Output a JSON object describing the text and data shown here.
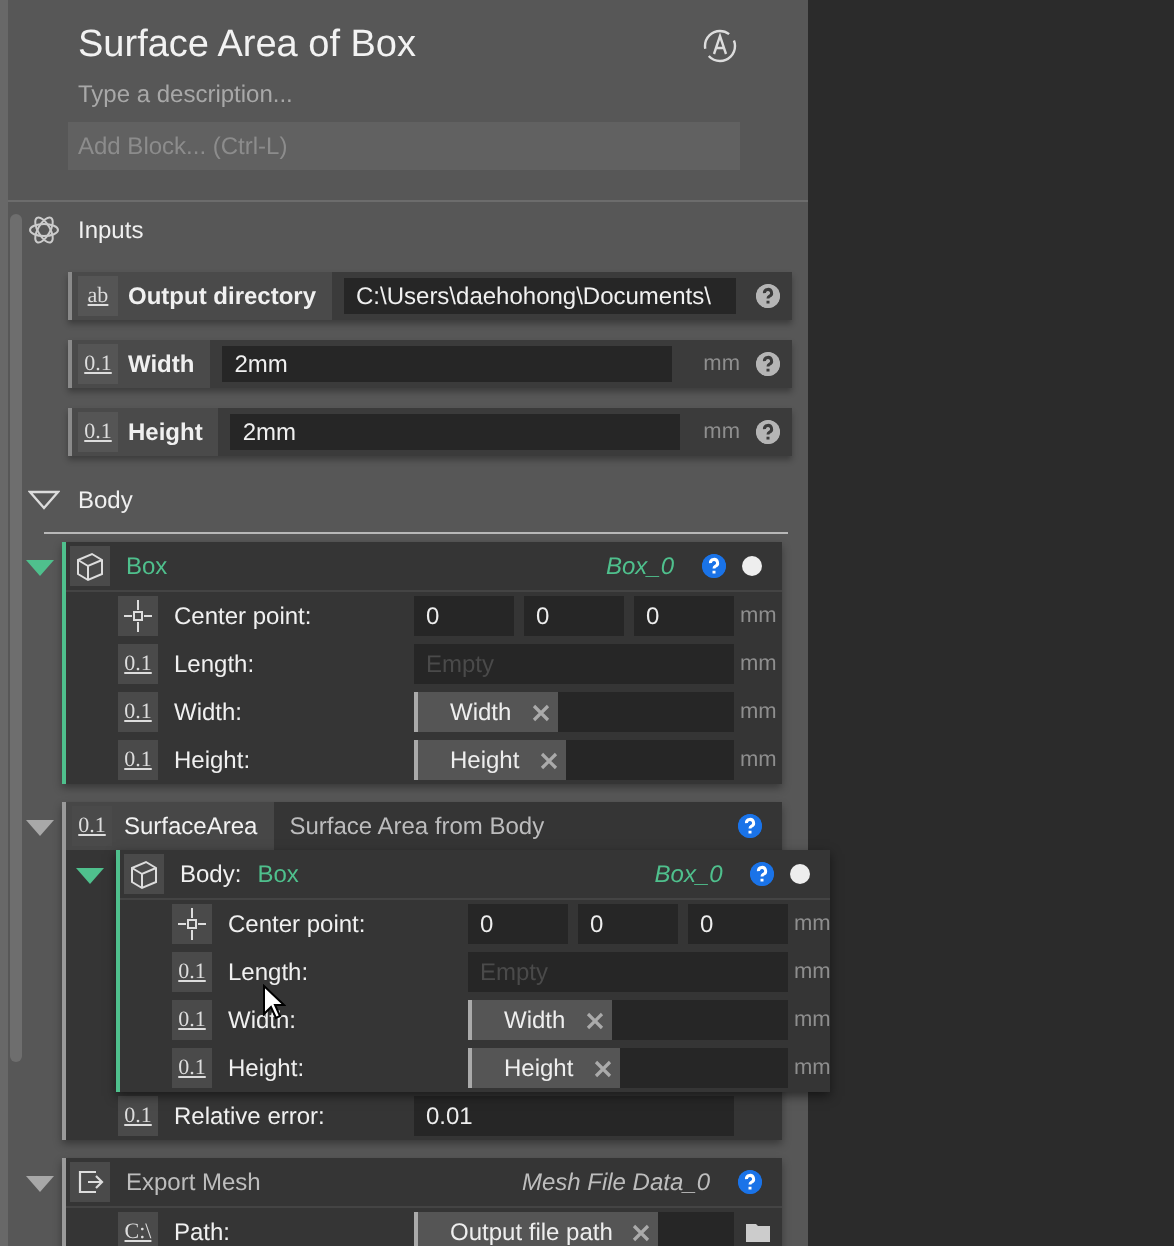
{
  "title": "Surface Area of Box",
  "description": {
    "placeholder": "Type a description..."
  },
  "add_block": {
    "placeholder": "Add Block... (Ctrl-L)"
  },
  "inputs": {
    "label": "Inputs",
    "rows": [
      {
        "icon": "ab",
        "label": "Output directory",
        "value": "C:\\Users\\daehohong\\Documents\\"
      },
      {
        "icon": "0.1",
        "label": "Width",
        "value": "2mm",
        "unit": "mm"
      },
      {
        "icon": "0.1",
        "label": "Height",
        "value": "2mm",
        "unit": "mm"
      }
    ]
  },
  "body": {
    "label": "Body"
  },
  "blocks": [
    {
      "kind": "geometry",
      "name": "Box",
      "ref": "Box_0",
      "params": [
        {
          "kind": "point",
          "label": "Center point:",
          "values": [
            "0",
            "0",
            "0"
          ],
          "unit": "mm"
        },
        {
          "kind": "number",
          "icon": "0.1",
          "label": "Length:",
          "placeholder": "Empty",
          "unit": "mm"
        },
        {
          "kind": "link",
          "icon": "0.1",
          "label": "Width:",
          "chip": "Width",
          "unit": "mm"
        },
        {
          "kind": "link",
          "icon": "0.1",
          "label": "Height:",
          "chip": "Height",
          "unit": "mm"
        }
      ]
    },
    {
      "kind": "function",
      "icon": "0.1",
      "name": "SurfaceArea",
      "description": "Surface Area from Body",
      "input": {
        "label": "Body:",
        "value": "Box",
        "ref": "Box_0",
        "params": [
          {
            "kind": "point",
            "label": "Center point:",
            "values": [
              "0",
              "0",
              "0"
            ],
            "unit": "mm"
          },
          {
            "kind": "number",
            "icon": "0.1",
            "label": "Length:",
            "placeholder": "Empty",
            "unit": "mm"
          },
          {
            "kind": "link",
            "icon": "0.1",
            "label": "Width:",
            "chip": "Width",
            "unit": "mm"
          },
          {
            "kind": "link",
            "icon": "0.1",
            "label": "Height:",
            "chip": "Height",
            "unit": "mm"
          }
        ]
      },
      "params": [
        {
          "kind": "number",
          "icon": "0.1",
          "label": "Relative error:",
          "value": "0.01"
        }
      ]
    },
    {
      "kind": "export",
      "name": "Export Mesh",
      "ref": "Mesh File Data_0",
      "params": [
        {
          "kind": "link",
          "icon": "C:\\",
          "label": "Path:",
          "chip": "Output file path",
          "folder": true
        }
      ]
    }
  ]
}
